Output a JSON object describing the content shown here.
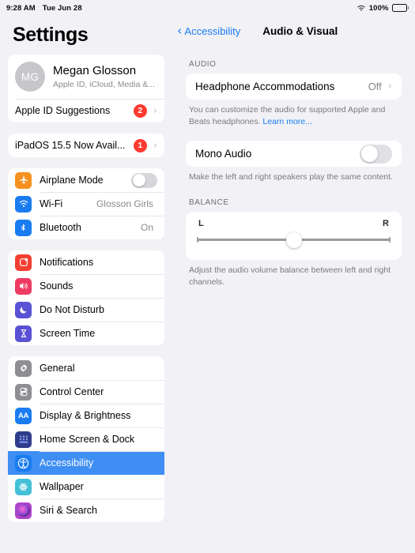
{
  "status_bar": {
    "time": "9:28 AM",
    "date": "Tue Jun 28",
    "wifi_icon": "wifi-icon",
    "battery_percent": "100%",
    "battery_icon": "battery-full-icon"
  },
  "sidebar": {
    "title": "Settings",
    "account": {
      "avatar_initials": "MG",
      "name": "Megan Glosson",
      "subtitle": "Apple ID, iCloud, Media &...",
      "suggestions_label": "Apple ID Suggestions",
      "suggestions_badge": "2",
      "chevron": "›"
    },
    "update": {
      "label": "iPadOS 15.5 Now Avail...",
      "badge": "1",
      "chevron": "›"
    },
    "groups": [
      {
        "items": [
          {
            "label": "Airplane Mode",
            "icon": "airplane-icon",
            "icon_color": "#f5911e",
            "control": "toggle",
            "toggle_on": false,
            "value": ""
          },
          {
            "label": "Wi-Fi",
            "icon": "wifi-icon",
            "icon_color": "#1a7cf0",
            "control": "value",
            "value": "Glosson Girls"
          },
          {
            "label": "Bluetooth",
            "icon": "bluetooth-icon",
            "icon_color": "#1a7cf0",
            "control": "value",
            "value": "On"
          }
        ]
      },
      {
        "items": [
          {
            "label": "Notifications",
            "icon": "notifications-icon",
            "icon_color": "#f43f32",
            "control": "none",
            "value": ""
          },
          {
            "label": "Sounds",
            "icon": "sounds-icon",
            "icon_color": "#ef3b63",
            "control": "none",
            "value": ""
          },
          {
            "label": "Do Not Disturb",
            "icon": "moon-icon",
            "icon_color": "#5a52d5",
            "control": "none",
            "value": ""
          },
          {
            "label": "Screen Time",
            "icon": "hourglass-icon",
            "icon_color": "#5a52d5",
            "control": "none",
            "value": ""
          }
        ]
      },
      {
        "items": [
          {
            "label": "General",
            "icon": "gear-icon",
            "icon_color": "#8e8e93",
            "control": "none",
            "value": ""
          },
          {
            "label": "Control Center",
            "icon": "control-center-icon",
            "icon_color": "#8e8e93",
            "control": "none",
            "value": ""
          },
          {
            "label": "Display & Brightness",
            "icon": "display-brightness-icon",
            "icon_color": "#1a7cf0",
            "control": "none",
            "value": ""
          },
          {
            "label": "Home Screen & Dock",
            "icon": "home-screen-dock-icon",
            "icon_color": "#2f3d8c",
            "control": "none",
            "value": ""
          },
          {
            "label": "Accessibility",
            "icon": "accessibility-icon",
            "icon_color": "#1a7cf0",
            "control": "none",
            "value": "",
            "selected": true
          },
          {
            "label": "Wallpaper",
            "icon": "wallpaper-icon",
            "icon_color": "#44c0d8",
            "control": "none",
            "value": ""
          },
          {
            "label": "Siri & Search",
            "icon": "siri-icon",
            "icon_color": "#b045c9",
            "control": "none",
            "value": ""
          }
        ]
      }
    ]
  },
  "detail": {
    "back_label": "Accessibility",
    "back_chevron": "‹",
    "title": "Audio & Visual",
    "audio_section": {
      "header": "AUDIO",
      "headphone_label": "Headphone Accommodations",
      "headphone_value": "Off",
      "headphone_chevron": "›",
      "headphone_footnote": "You can customize the audio for supported Apple and Beats headphones. ",
      "headphone_link": "Learn more...",
      "mono_label": "Mono Audio",
      "mono_on": false,
      "mono_footnote": "Make the left and right speakers play the same content."
    },
    "balance_section": {
      "header": "BALANCE",
      "left_label": "L",
      "right_label": "R",
      "value_percent": 50,
      "footnote": "Adjust the audio volume balance between left and right channels."
    }
  },
  "colors": {
    "accent_blue": "#1a7cf0",
    "selection_blue": "#3e8ef3",
    "badge_red": "#ff3b30",
    "page_bg": "#f1f1f6",
    "card_bg": "#ffffff"
  }
}
